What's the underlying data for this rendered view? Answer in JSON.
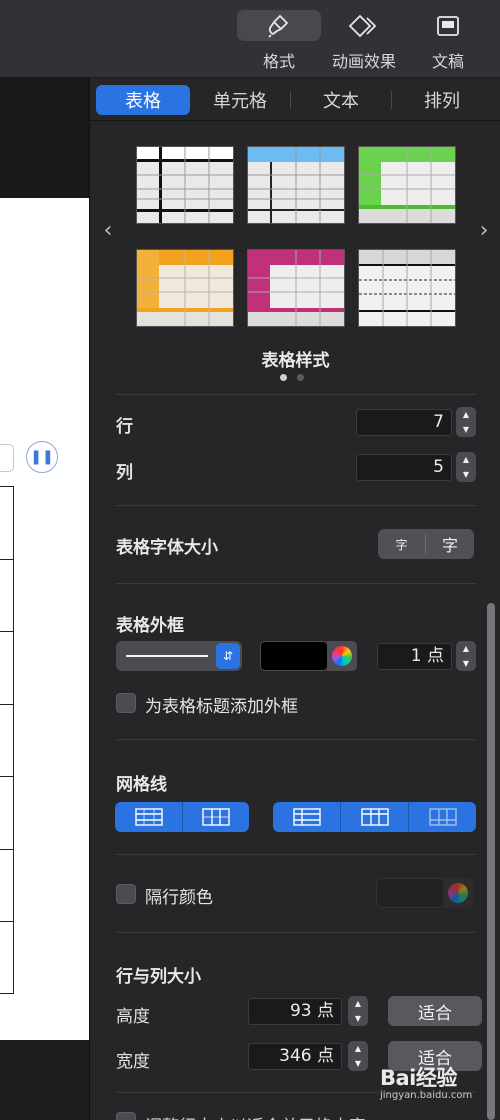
{
  "toolbar": {
    "format_label": "格式",
    "animate_label": "动画效果",
    "document_label": "文稿"
  },
  "tabs": [
    "表格",
    "单元格",
    "文本",
    "排列"
  ],
  "table_styles": {
    "label": "表格样式",
    "page_count": 2,
    "current_page": 1,
    "styles": [
      {
        "name": "plain-black",
        "header": "#ffffff",
        "accent": "#111111"
      },
      {
        "name": "blue",
        "header": "#6bbcf0",
        "accent": "#222222"
      },
      {
        "name": "green",
        "header": "#6bd24e",
        "accent": "#4cbd30"
      },
      {
        "name": "orange",
        "header": "#f2a21e",
        "accent": "#f2a21e"
      },
      {
        "name": "magenta",
        "header": "#c0317a",
        "accent": "#c0317a"
      },
      {
        "name": "gray-dashed",
        "header": "#d7d7d7",
        "accent": "#111111"
      }
    ]
  },
  "rows": {
    "label": "行",
    "value": "7"
  },
  "columns": {
    "label": "列",
    "value": "5"
  },
  "font_size": {
    "label": "表格字体大小",
    "smaller": "字",
    "larger": "字"
  },
  "outline": {
    "title": "表格外框",
    "color": "#000000",
    "width_value": "1 点",
    "title_border_label": "为表格标题添加外框",
    "title_border_checked": false
  },
  "gridlines": {
    "title": "网格线"
  },
  "alternating": {
    "label": "隔行颜色",
    "checked": false
  },
  "size": {
    "title": "行与列大小",
    "height_label": "高度",
    "height_value": "93 点",
    "width_label": "宽度",
    "width_value": "346 点",
    "fit_label": "适合",
    "cut_text": "调整行大小以适合单元格内容"
  },
  "watermark": {
    "logo": "Bai经验",
    "url": "jingyan.baidu.com"
  }
}
